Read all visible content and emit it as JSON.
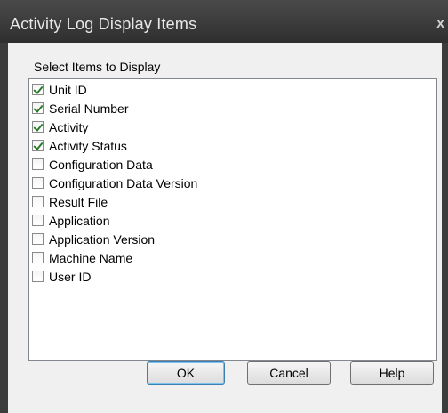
{
  "window": {
    "title": "Activity Log Display Items",
    "close_glyph": "x"
  },
  "group": {
    "label": "Select Items to Display"
  },
  "items": [
    {
      "label": "Unit ID",
      "checked": true
    },
    {
      "label": "Serial Number",
      "checked": true
    },
    {
      "label": "Activity",
      "checked": true
    },
    {
      "label": "Activity Status",
      "checked": true
    },
    {
      "label": "Configuration Data",
      "checked": false
    },
    {
      "label": "Configuration Data Version",
      "checked": false
    },
    {
      "label": "Result File",
      "checked": false
    },
    {
      "label": "Application",
      "checked": false
    },
    {
      "label": "Application Version",
      "checked": false
    },
    {
      "label": "Machine Name",
      "checked": false
    },
    {
      "label": "User ID",
      "checked": false
    }
  ],
  "buttons": {
    "ok": "OK",
    "cancel": "Cancel",
    "help": "Help"
  }
}
